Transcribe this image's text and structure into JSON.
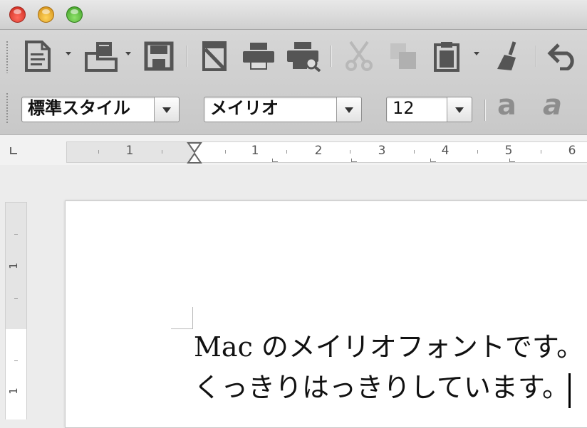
{
  "window": {
    "buttons": [
      "close",
      "minimize",
      "zoom"
    ]
  },
  "toolbar": {
    "icons": [
      "new-document-icon",
      "open-folder-icon",
      "save-icon",
      "export-pdf-icon",
      "print-icon",
      "print-preview-icon",
      "cut-icon",
      "copy-icon",
      "paste-icon",
      "clone-formatting-icon",
      "undo-icon"
    ]
  },
  "formatting": {
    "paragraph_style": "標準スタイル",
    "font_name": "メイリオ",
    "font_size": "12",
    "style_a_1": "a",
    "style_a_2": "a"
  },
  "hruler": {
    "labels": [
      "1",
      "1",
      "2",
      "3",
      "4",
      "5",
      "6"
    ]
  },
  "vruler": {
    "labels": [
      "1",
      "1"
    ]
  },
  "document": {
    "line1": "Mac のメイリオフォントです。",
    "line2": "くっきりはっきりしています。"
  },
  "colors": {
    "icon": "#555555",
    "icon_disabled": "#b8b8b8",
    "toolbar_bg": "#cfcfcf"
  }
}
